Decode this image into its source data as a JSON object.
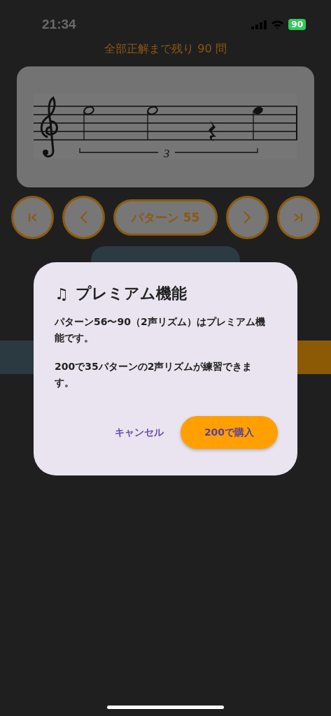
{
  "status_bar": {
    "time": "21:34",
    "battery": "90"
  },
  "remaining_label": "全部正解まで残り 90 問",
  "nav": {
    "pattern_label": "パターン 55"
  },
  "score": {
    "tuplet_number": "3"
  },
  "dialog": {
    "icon": "♫",
    "title": "プレミアム機能",
    "paragraphs": [
      "パターン56〜90（2声リズム）はプレミアム機能です。",
      "200で35パターンの2声リズムが練習できます。"
    ],
    "cancel": "キャンセル",
    "confirm": "200で購入"
  }
}
